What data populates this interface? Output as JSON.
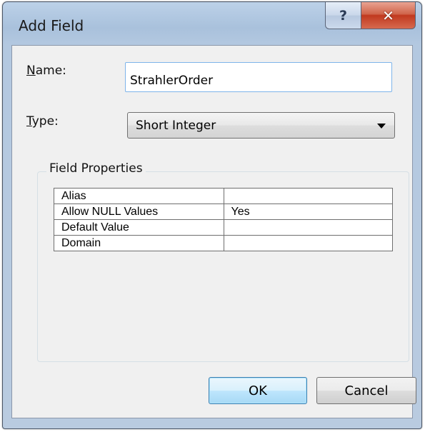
{
  "window": {
    "title": "Add Field",
    "help_glyph": "?",
    "close_glyph": "✕"
  },
  "name": {
    "label_accel": "N",
    "label_rest": "ame:",
    "value": "StrahlerOrder"
  },
  "type": {
    "label_accel": "T",
    "label_rest": "ype:",
    "selected": "Short Integer"
  },
  "field_properties": {
    "title": "Field Properties",
    "rows": [
      {
        "property": "Alias",
        "value": ""
      },
      {
        "property": "Allow NULL Values",
        "value": "Yes"
      },
      {
        "property": "Default Value",
        "value": ""
      },
      {
        "property": "Domain",
        "value": ""
      }
    ]
  },
  "buttons": {
    "ok": "OK",
    "cancel": "Cancel"
  },
  "colors": {
    "ok_border": "#3c7fb1",
    "close_red": "#c1391f",
    "input_border": "#7eb4ea"
  }
}
